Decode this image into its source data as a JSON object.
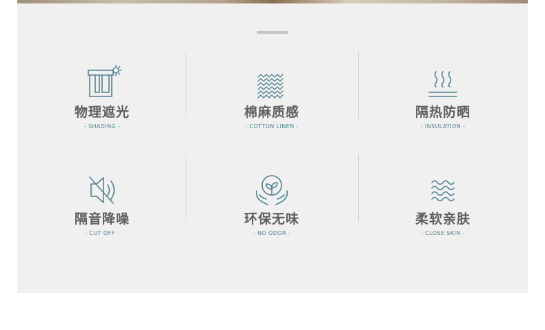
{
  "features": [
    {
      "title": "物理遮光",
      "subtitle": "- SHADING -",
      "icon": "curtain-sun-icon"
    },
    {
      "title": "棉麻质感",
      "subtitle": "- COTTON LINEN -",
      "icon": "weave-texture-icon"
    },
    {
      "title": "隔热防晒",
      "subtitle": "- INSULATION -",
      "icon": "heat-waves-icon"
    },
    {
      "title": "隔音降噪",
      "subtitle": "- CUT OFF -",
      "icon": "speaker-mute-icon"
    },
    {
      "title": "环保无味",
      "subtitle": "- NO ODOR -",
      "icon": "sprout-hands-icon"
    },
    {
      "title": "柔软亲肤",
      "subtitle": "- CLOSE SKIN -",
      "icon": "soft-waves-icon"
    }
  ],
  "colors": {
    "accent": "#4f8190",
    "title": "#5f5f5f",
    "panel": "#f0f0f0"
  }
}
